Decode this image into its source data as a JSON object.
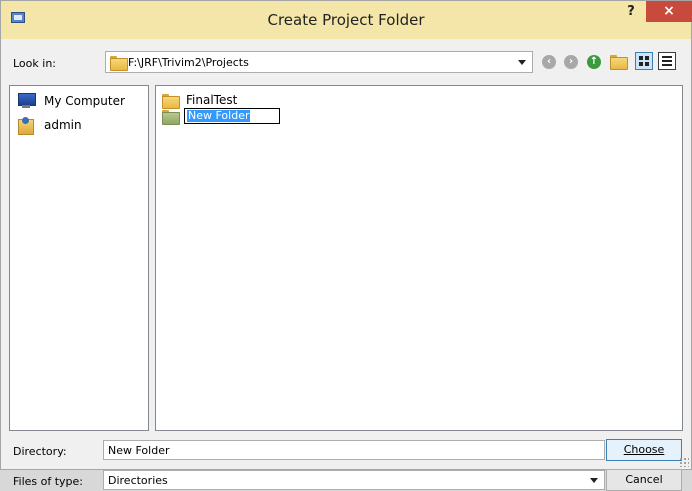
{
  "window": {
    "title": "Create Project Folder",
    "help_label": "?",
    "close_label": "×"
  },
  "look_in": {
    "label": "Look in:",
    "path": "F:\\JRF\\Trivim2\\Projects"
  },
  "sidebar": {
    "items": [
      {
        "label": "My Computer",
        "icon": "computer-icon"
      },
      {
        "label": "admin",
        "icon": "user-folder-icon"
      }
    ]
  },
  "files": {
    "items": [
      {
        "label": "FinalTest"
      }
    ],
    "rename_value": "New Folder"
  },
  "directory": {
    "label": "Directory:",
    "value": "New Folder"
  },
  "files_of_type": {
    "label": "Files of type:",
    "value": "Directories"
  },
  "buttons": {
    "choose": "Choose",
    "cancel": "Cancel"
  },
  "colors": {
    "titlebar": "#f3e6a8",
    "close": "#c74a3c",
    "selection": "#3399ff"
  }
}
